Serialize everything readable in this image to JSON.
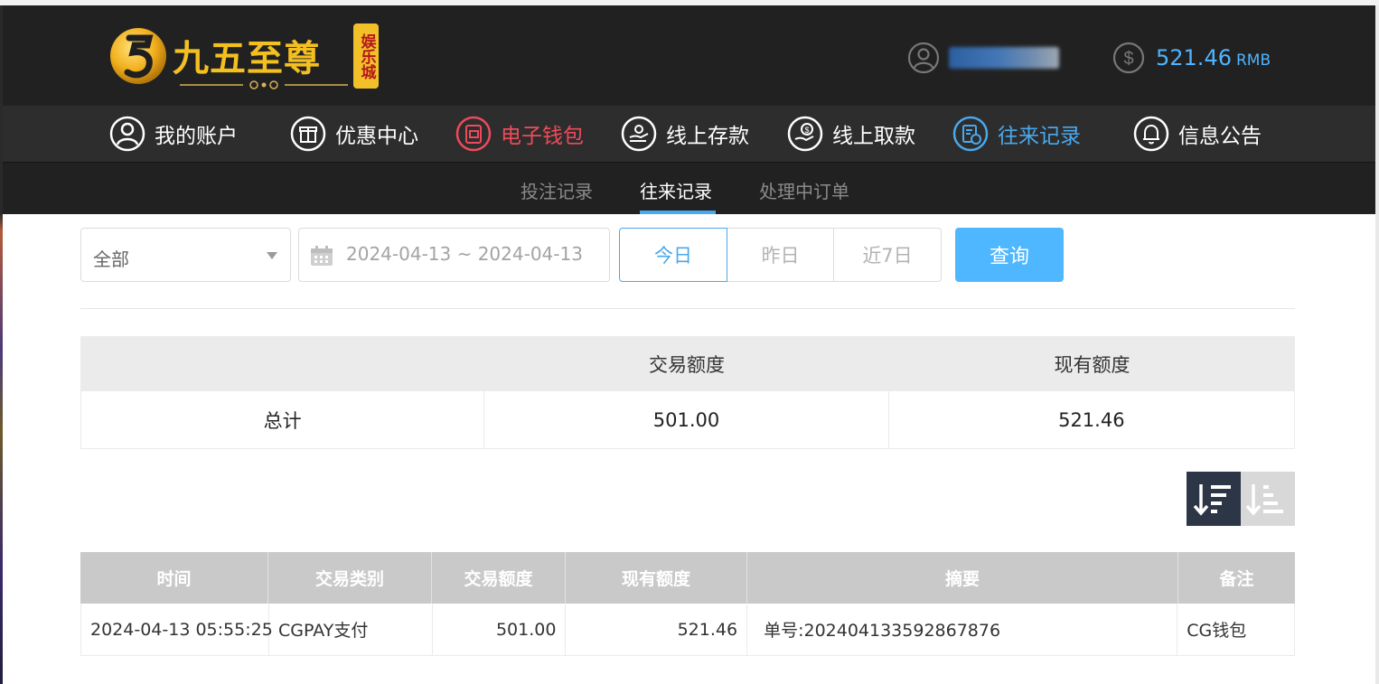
{
  "header": {
    "logo_title": "九五至尊",
    "logo_badge": "娱乐城",
    "balance_value": "521.46",
    "balance_unit": "RMB"
  },
  "nav": [
    {
      "label": "我的账户",
      "icon": "user-icon"
    },
    {
      "label": "优惠中心",
      "icon": "gift-icon"
    },
    {
      "label": "电子钱包",
      "icon": "wallet-icon"
    },
    {
      "label": "线上存款",
      "icon": "deposit-icon"
    },
    {
      "label": "线上取款",
      "icon": "withdraw-icon"
    },
    {
      "label": "往来记录",
      "icon": "records-icon"
    },
    {
      "label": "信息公告",
      "icon": "bell-icon"
    }
  ],
  "subnav": [
    "投注记录",
    "往来记录",
    "处理中订单"
  ],
  "filters": {
    "type": "全部",
    "date_range": "2024-04-13 ~ 2024-04-13",
    "today": "今日",
    "yesterday": "昨日",
    "last7": "近7日",
    "query": "查询"
  },
  "summary": {
    "headers": [
      "",
      "交易额度",
      "现有额度"
    ],
    "label": "总计",
    "transaction": "501.00",
    "current": "521.46"
  },
  "records": {
    "headers": [
      "时间",
      "交易类别",
      "交易额度",
      "现有额度",
      "摘要",
      "备注"
    ],
    "rows": [
      {
        "time": "2024-04-13 05:55:25",
        "type": "CGPAY支付",
        "amount": "501.00",
        "balance": "521.46",
        "summary": "单号:202404133592867876",
        "note": "CG钱包"
      }
    ]
  },
  "colors": {
    "accent": "#4aa8ec",
    "active_nav_red": "#ef4b5a",
    "logo_gold": "#f4c020",
    "query_btn": "#4fb7ff",
    "sort_active": "#2c3646"
  }
}
